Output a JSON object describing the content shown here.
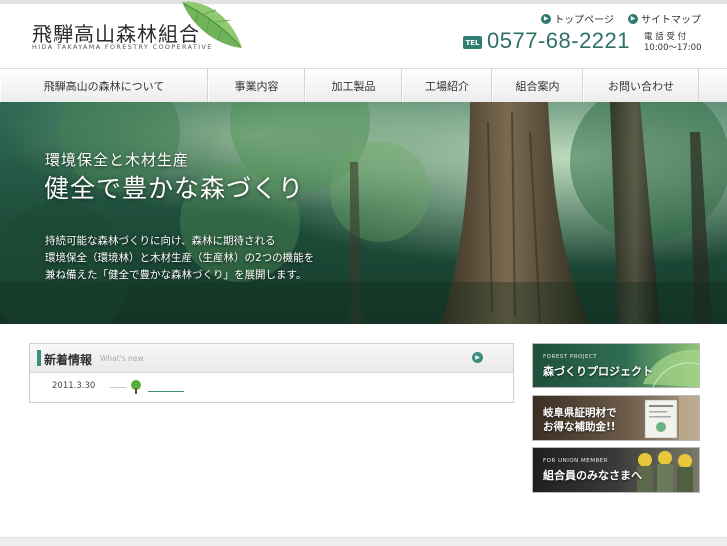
{
  "header": {
    "logo_jp": "飛騨高山森林組合",
    "logo_en": "HIDA TAKAYAMA FORESTRY COOPERATIVE",
    "top_links": [
      {
        "label": "トップページ"
      },
      {
        "label": "サイトマップ"
      }
    ],
    "tel_badge": "TEL",
    "tel_number": "0577-68-2221",
    "tel_label": "電 話 受 付",
    "tel_hours": "10:00〜17:00"
  },
  "nav": {
    "items": [
      {
        "label": "飛騨高山の森林について"
      },
      {
        "label": "事業内容"
      },
      {
        "label": "加工製品"
      },
      {
        "label": "工場紹介"
      },
      {
        "label": "組合案内"
      },
      {
        "label": "お問い合わせ"
      }
    ]
  },
  "hero": {
    "subtitle": "環境保全と木材生産",
    "title": "健全で豊かな森づくり",
    "body": [
      "持続可能な森林づくりに向け、森林に期待される",
      "環境保全（環境林）と木材生産（生産林）の2つの機能を",
      "兼ね備えた「健全で豊かな森林づくり」を展開します。"
    ]
  },
  "news": {
    "title": "新着情報",
    "subtitle": "What's new",
    "items": [
      {
        "date": "2011.3.30"
      }
    ]
  },
  "banners": [
    {
      "small": "FOREST PROJECT",
      "big": "森づくりプロジェクト"
    },
    {
      "small": "",
      "big_line1": "岐阜県証明材で",
      "big_line2": "お得な補助金!!"
    },
    {
      "small": "FOR UNION MEMBER",
      "big": "組合員のみなさまへ"
    }
  ],
  "colors": {
    "accent": "#2f7e73",
    "nav_bg": "#ececec",
    "hero_bg": "#1e4d3a"
  }
}
